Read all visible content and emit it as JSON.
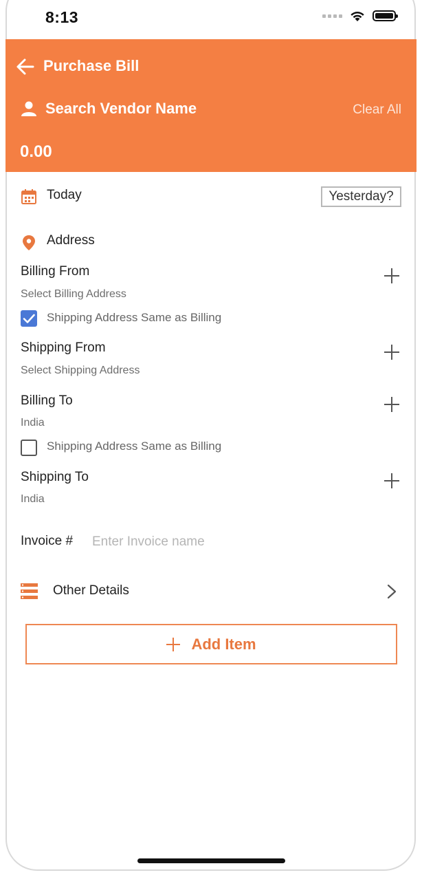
{
  "status_bar": {
    "time": "8:13"
  },
  "header": {
    "title": "Purchase Bill",
    "vendor_placeholder": "Search Vendor Name",
    "clear_all": "Clear All",
    "amount": "0.00"
  },
  "date": {
    "label": "Today",
    "alt_button": "Yesterday?"
  },
  "address": {
    "section_title": "Address",
    "billing_from": {
      "label": "Billing From",
      "value": "Select Billing Address"
    },
    "billing_from_same": {
      "label": "Shipping Address Same as Billing",
      "checked": true
    },
    "shipping_from": {
      "label": "Shipping From",
      "value": "Select Shipping Address"
    },
    "billing_to": {
      "label": "Billing To",
      "value": "India"
    },
    "billing_to_same": {
      "label": "Shipping Address Same as Billing",
      "checked": false
    },
    "shipping_to": {
      "label": "Shipping To",
      "value": "India"
    }
  },
  "invoice": {
    "label": "Invoice #",
    "value": "",
    "placeholder": "Enter Invoice name"
  },
  "other_details": {
    "label": "Other Details"
  },
  "add_item": {
    "label": "Add Item"
  },
  "colors": {
    "accent": "#f47f43",
    "checkbox_checked": "#4a78d6"
  },
  "icons": {
    "back": "arrow-left-icon",
    "vendor": "person-icon",
    "date": "calendar-icon",
    "address": "location-pin-icon",
    "details": "list-icon",
    "chevron": "chevron-right-icon"
  }
}
